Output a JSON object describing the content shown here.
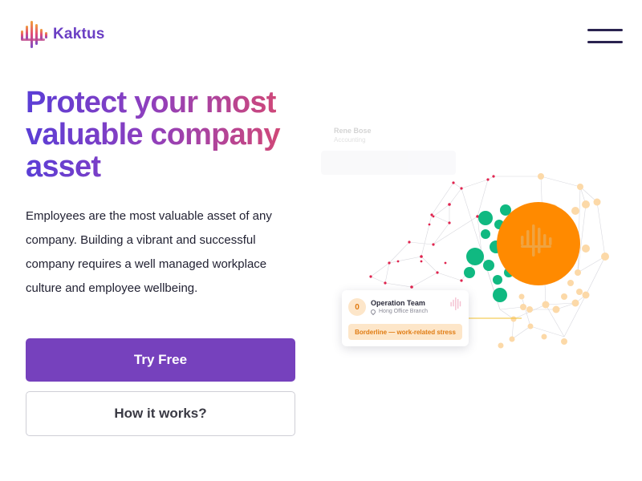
{
  "brand": {
    "name": "Kaktus",
    "accent_color": "#7641bd",
    "logo_gradient": [
      "#7b4cc7",
      "#e04b7a",
      "#f2a23a"
    ]
  },
  "header": {
    "menu_icon": "hamburger-menu-icon"
  },
  "hero": {
    "headline": "Protect your most valuable company asset",
    "description": "Employees are the most valuable asset of any company. Building a vibrant and successful company requires a well managed workplace culture and employee wellbeing.",
    "primary_button": "Try Free",
    "secondary_button": "How it works?"
  },
  "illustration": {
    "ghost_card": {
      "name": "Rene Bose",
      "subtitle": "Accounting"
    },
    "team_card": {
      "count": "0",
      "team_name": "Operation Team",
      "branch": "Hong Office Branch",
      "status": "Borderline — work-related stress",
      "status_color": "#e07b12"
    },
    "colors": {
      "red_nodes": "#e0234e",
      "green_nodes": "#10b981",
      "orange_nodes": "#fcd9a8",
      "center_circle": "#ff8a00"
    }
  }
}
